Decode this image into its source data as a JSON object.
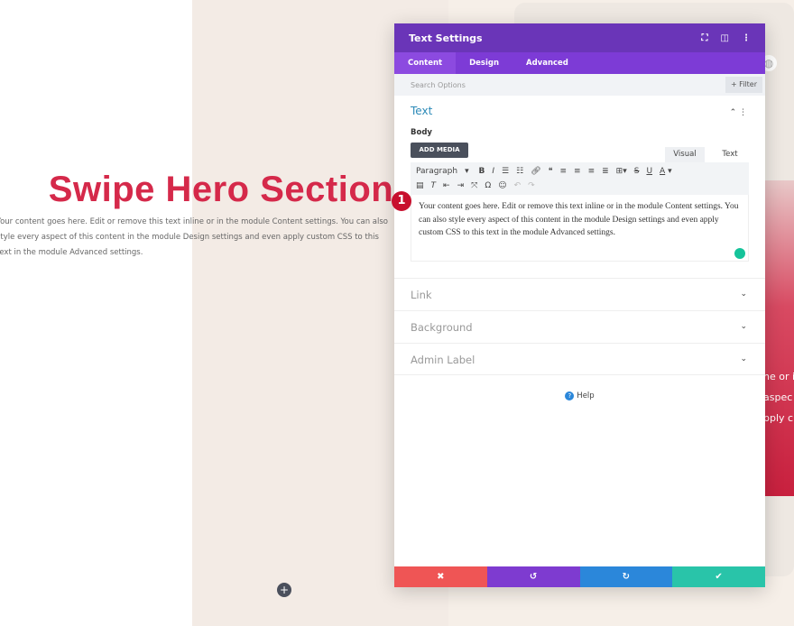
{
  "page": {
    "title": "Swipe Hero Section",
    "body": "Your content goes here. Edit or remove this text inline or in the module Content settings. You can also style every aspect of this content in the module Design settings and even apply custom CSS to this text in the module Advanced settings.",
    "right_fragments": [
      "ne or i",
      "aspec",
      "pply cu"
    ]
  },
  "panel": {
    "title": "Text Settings",
    "tabs": [
      "Content",
      "Design",
      "Advanced"
    ],
    "search_placeholder": "Search Options",
    "filter_label": "+ Filter",
    "text_section": {
      "title": "Text",
      "body_label": "Body",
      "add_media": "ADD MEDIA",
      "modes": [
        "Visual",
        "Text"
      ],
      "format": "Paragraph",
      "content": "Your content goes here. Edit or remove this text inline or in the module Content settings. You can also style every aspect of this content in the module Design settings and even apply custom CSS to this text in the module Advanced settings."
    },
    "sections": [
      "Link",
      "Background",
      "Admin Label"
    ],
    "help": "Help",
    "step_badge": "1"
  },
  "colors": {
    "header": "#6a35b8",
    "tabs": "#7d3bd6",
    "accent_title": "#d5294a",
    "cancel": "#ef5555",
    "undo": "#7e3bd0",
    "redo": "#2b87da",
    "save": "#29c4a9"
  }
}
